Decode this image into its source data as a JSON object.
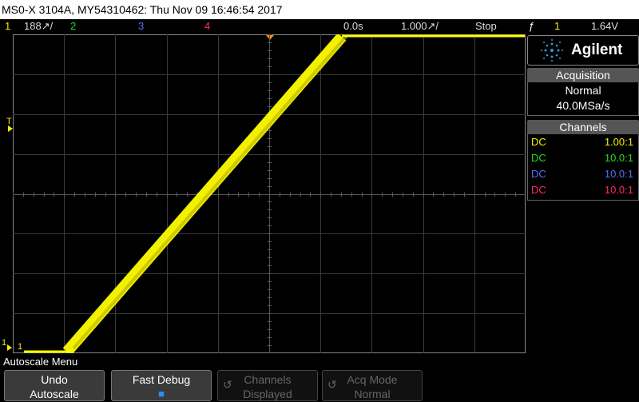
{
  "titlebar": {
    "text": "MS0-X 3104A, MY54310462: Thu Nov 09 16:46:54 2017"
  },
  "status": {
    "ch1": "1",
    "ch1_scale": "188↗/",
    "ch2": "2",
    "ch3": "3",
    "ch4": "4",
    "time_pos": "0.0s",
    "time_scale": "1.000↗/",
    "run_state": "Stop",
    "trigger_symbol": "ƒ",
    "trigger_ch": "1",
    "trigger_level": "1.64V"
  },
  "colors": {
    "ch1": "#f5f000",
    "ch2": "#22dd22",
    "ch3": "#5a6cff",
    "ch4": "#ff2a6a",
    "trace": "#ffff00"
  },
  "markers": {
    "trigger_T": "T",
    "ground_1": "1",
    "ground_1b": "1"
  },
  "sidebar": {
    "brand": "Agilent",
    "acquisition": {
      "header": "Acquisition",
      "mode": "Normal",
      "rate": "40.0MSa/s"
    },
    "channels": {
      "header": "Channels",
      "rows": [
        {
          "coupling": "DC",
          "probe": "1.00:1"
        },
        {
          "coupling": "DC",
          "probe": "10.0:1"
        },
        {
          "coupling": "DC",
          "probe": "10.0:1"
        },
        {
          "coupling": "DC",
          "probe": "10.0:1"
        }
      ]
    }
  },
  "menu": {
    "title": "Autoscale Menu"
  },
  "softkeys": [
    {
      "line1": "Undo",
      "line2": "Autoscale"
    },
    {
      "line1": "Fast Debug",
      "line2": "■"
    },
    {
      "line1": "Channels",
      "line2": "Displayed",
      "icon": "↺"
    },
    {
      "line1": "Acq Mode",
      "line2": "Normal",
      "icon": "↺"
    }
  ]
}
